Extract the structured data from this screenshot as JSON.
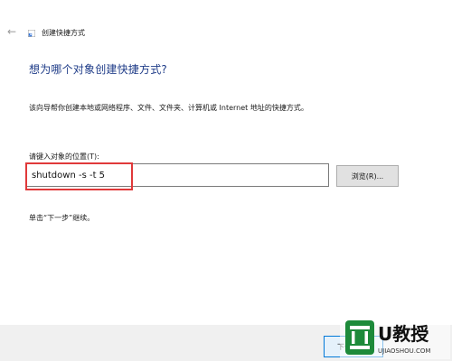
{
  "window": {
    "title": "创建快捷方式",
    "back_icon": "←",
    "title_icon": "shortcut-icon"
  },
  "main": {
    "heading": "想为哪个对象创建快捷方式?",
    "description": "该向导帮你创建本地或网络程序、文件、文件夹、计算机或 Internet 地址的快捷方式。",
    "field_label": "请键入对象的位置(T):",
    "location_value": "shutdown -s -t 5",
    "browse_label": "浏览(R)...",
    "hint": "单击“下一步”继续。"
  },
  "footer": {
    "next_label": "下一步"
  },
  "watermark": {
    "brand_text": "U教授",
    "site_text": "UJIAOSHOU.COM"
  },
  "colors": {
    "heading": "#1f3c88",
    "highlight": "#e0393a",
    "watermark_green": "#1d8a3a",
    "button_face": "#e1e1e1"
  }
}
